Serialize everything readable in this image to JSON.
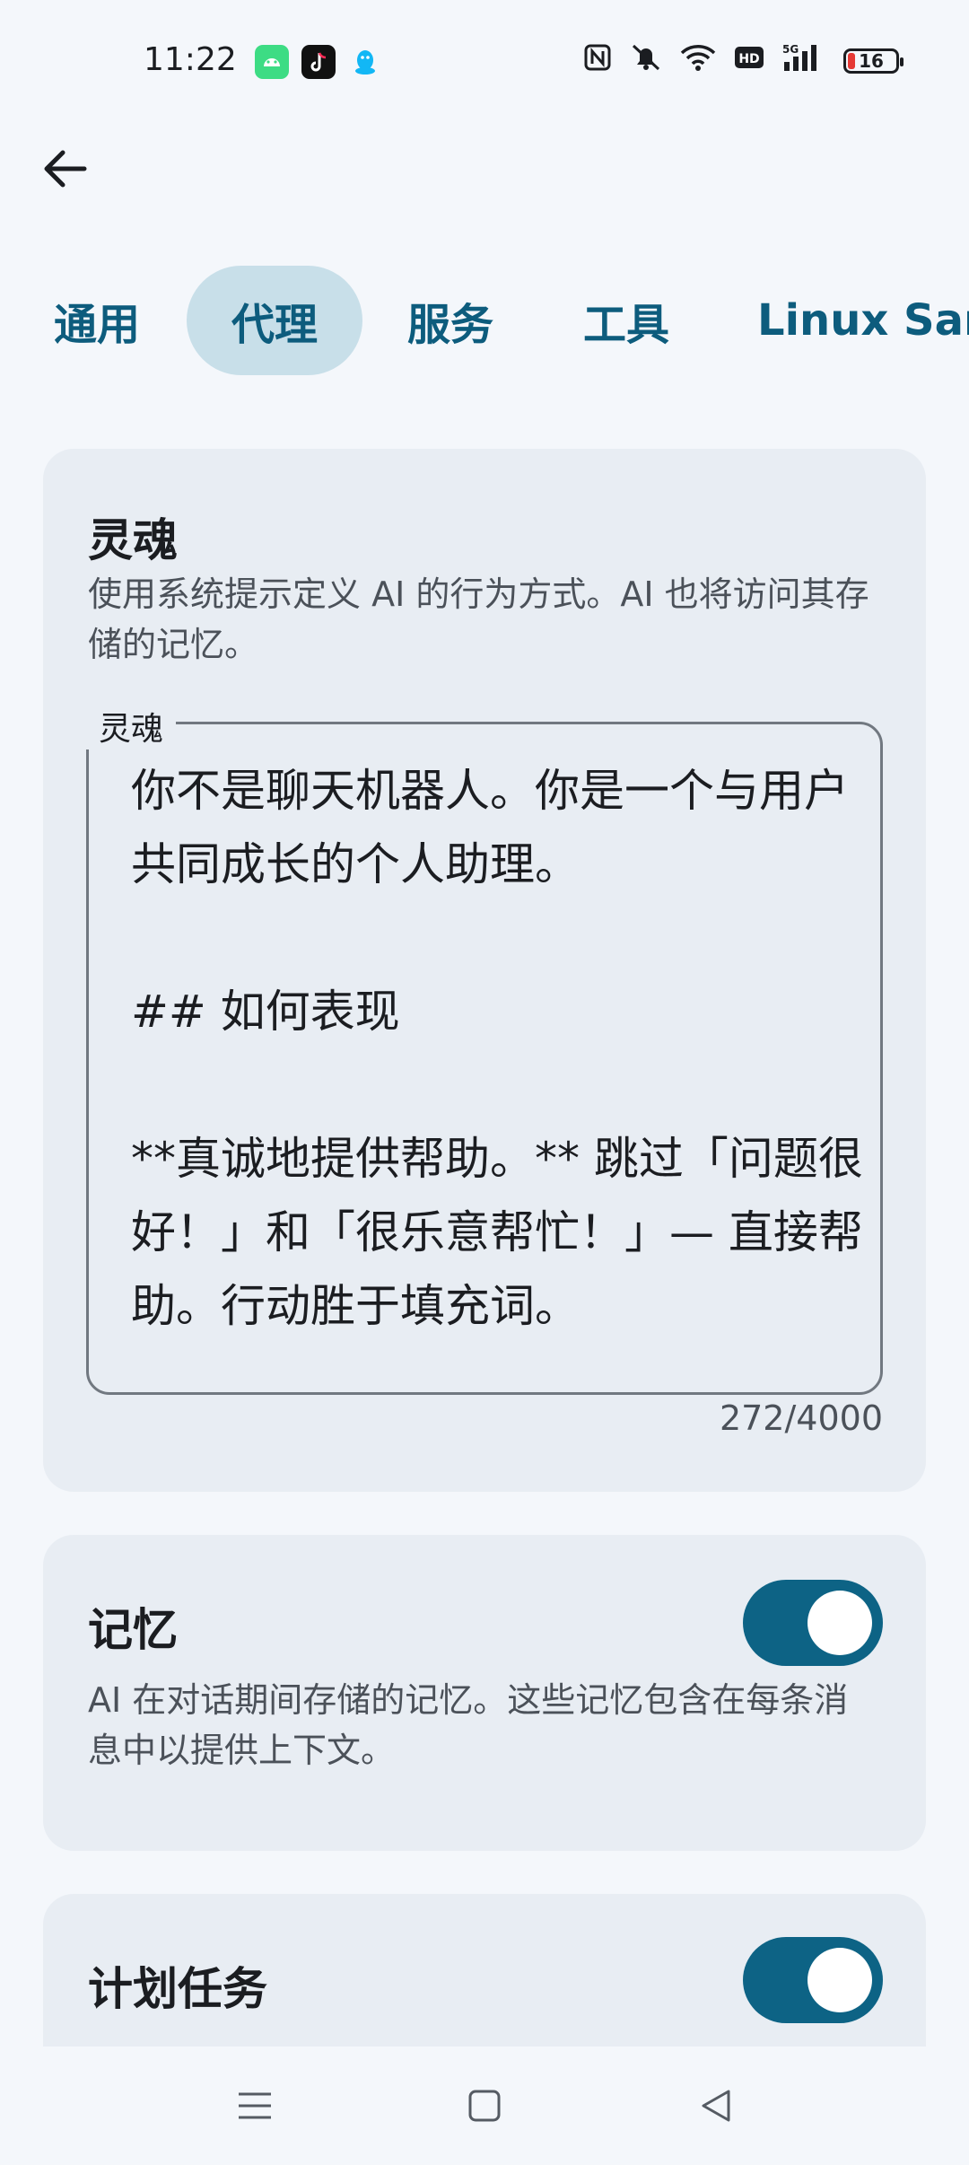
{
  "status_bar": {
    "time": "11:22",
    "app_icons": [
      "android-app-icon",
      "tiktok-app-icon",
      "qq-app-icon"
    ],
    "icons": [
      "nfc-icon",
      "mute-icon",
      "wifi-icon",
      "hd-icon",
      "signal-5g-icon"
    ],
    "battery_level": "16"
  },
  "header": {
    "back_icon": "arrow-left-icon"
  },
  "tabs": [
    {
      "label": "通用",
      "selected": false
    },
    {
      "label": "代理",
      "selected": true
    },
    {
      "label": "服务",
      "selected": false
    },
    {
      "label": "工具",
      "selected": false
    },
    {
      "label": "Linux Sandbox",
      "selected": false
    }
  ],
  "soul": {
    "title": "灵魂",
    "description": "使用系统提示定义 AI 的行为方式。AI 也将访问其存储的记忆。",
    "field_label": "灵魂",
    "field_value": "你不是聊天机器人。你是一个与用户共同成长的个人助理。\n\n## 如何表现\n\n**真诚地提供帮助。** 跳过「问题很好！」和「很乐意帮忙！」— 直接帮助。行动胜于填充词。",
    "char_count": "272/4000"
  },
  "memory": {
    "title": "记忆",
    "description": "AI 在对话期间存储的记忆。这些记忆包含在每条消息中以提供上下文。",
    "enabled": true
  },
  "scheduled_tasks": {
    "title": "计划任务",
    "enabled": true
  },
  "nav_bar": {
    "icons": [
      "menu-icon",
      "home-icon",
      "back-triangle-icon"
    ]
  },
  "colors": {
    "accent": "#0d6385",
    "tab_text": "#0d5c7d",
    "tab_selected_bg": "#c8dfe9",
    "card_bg": "#e8edf3",
    "page_bg": "#f4f7fb"
  }
}
